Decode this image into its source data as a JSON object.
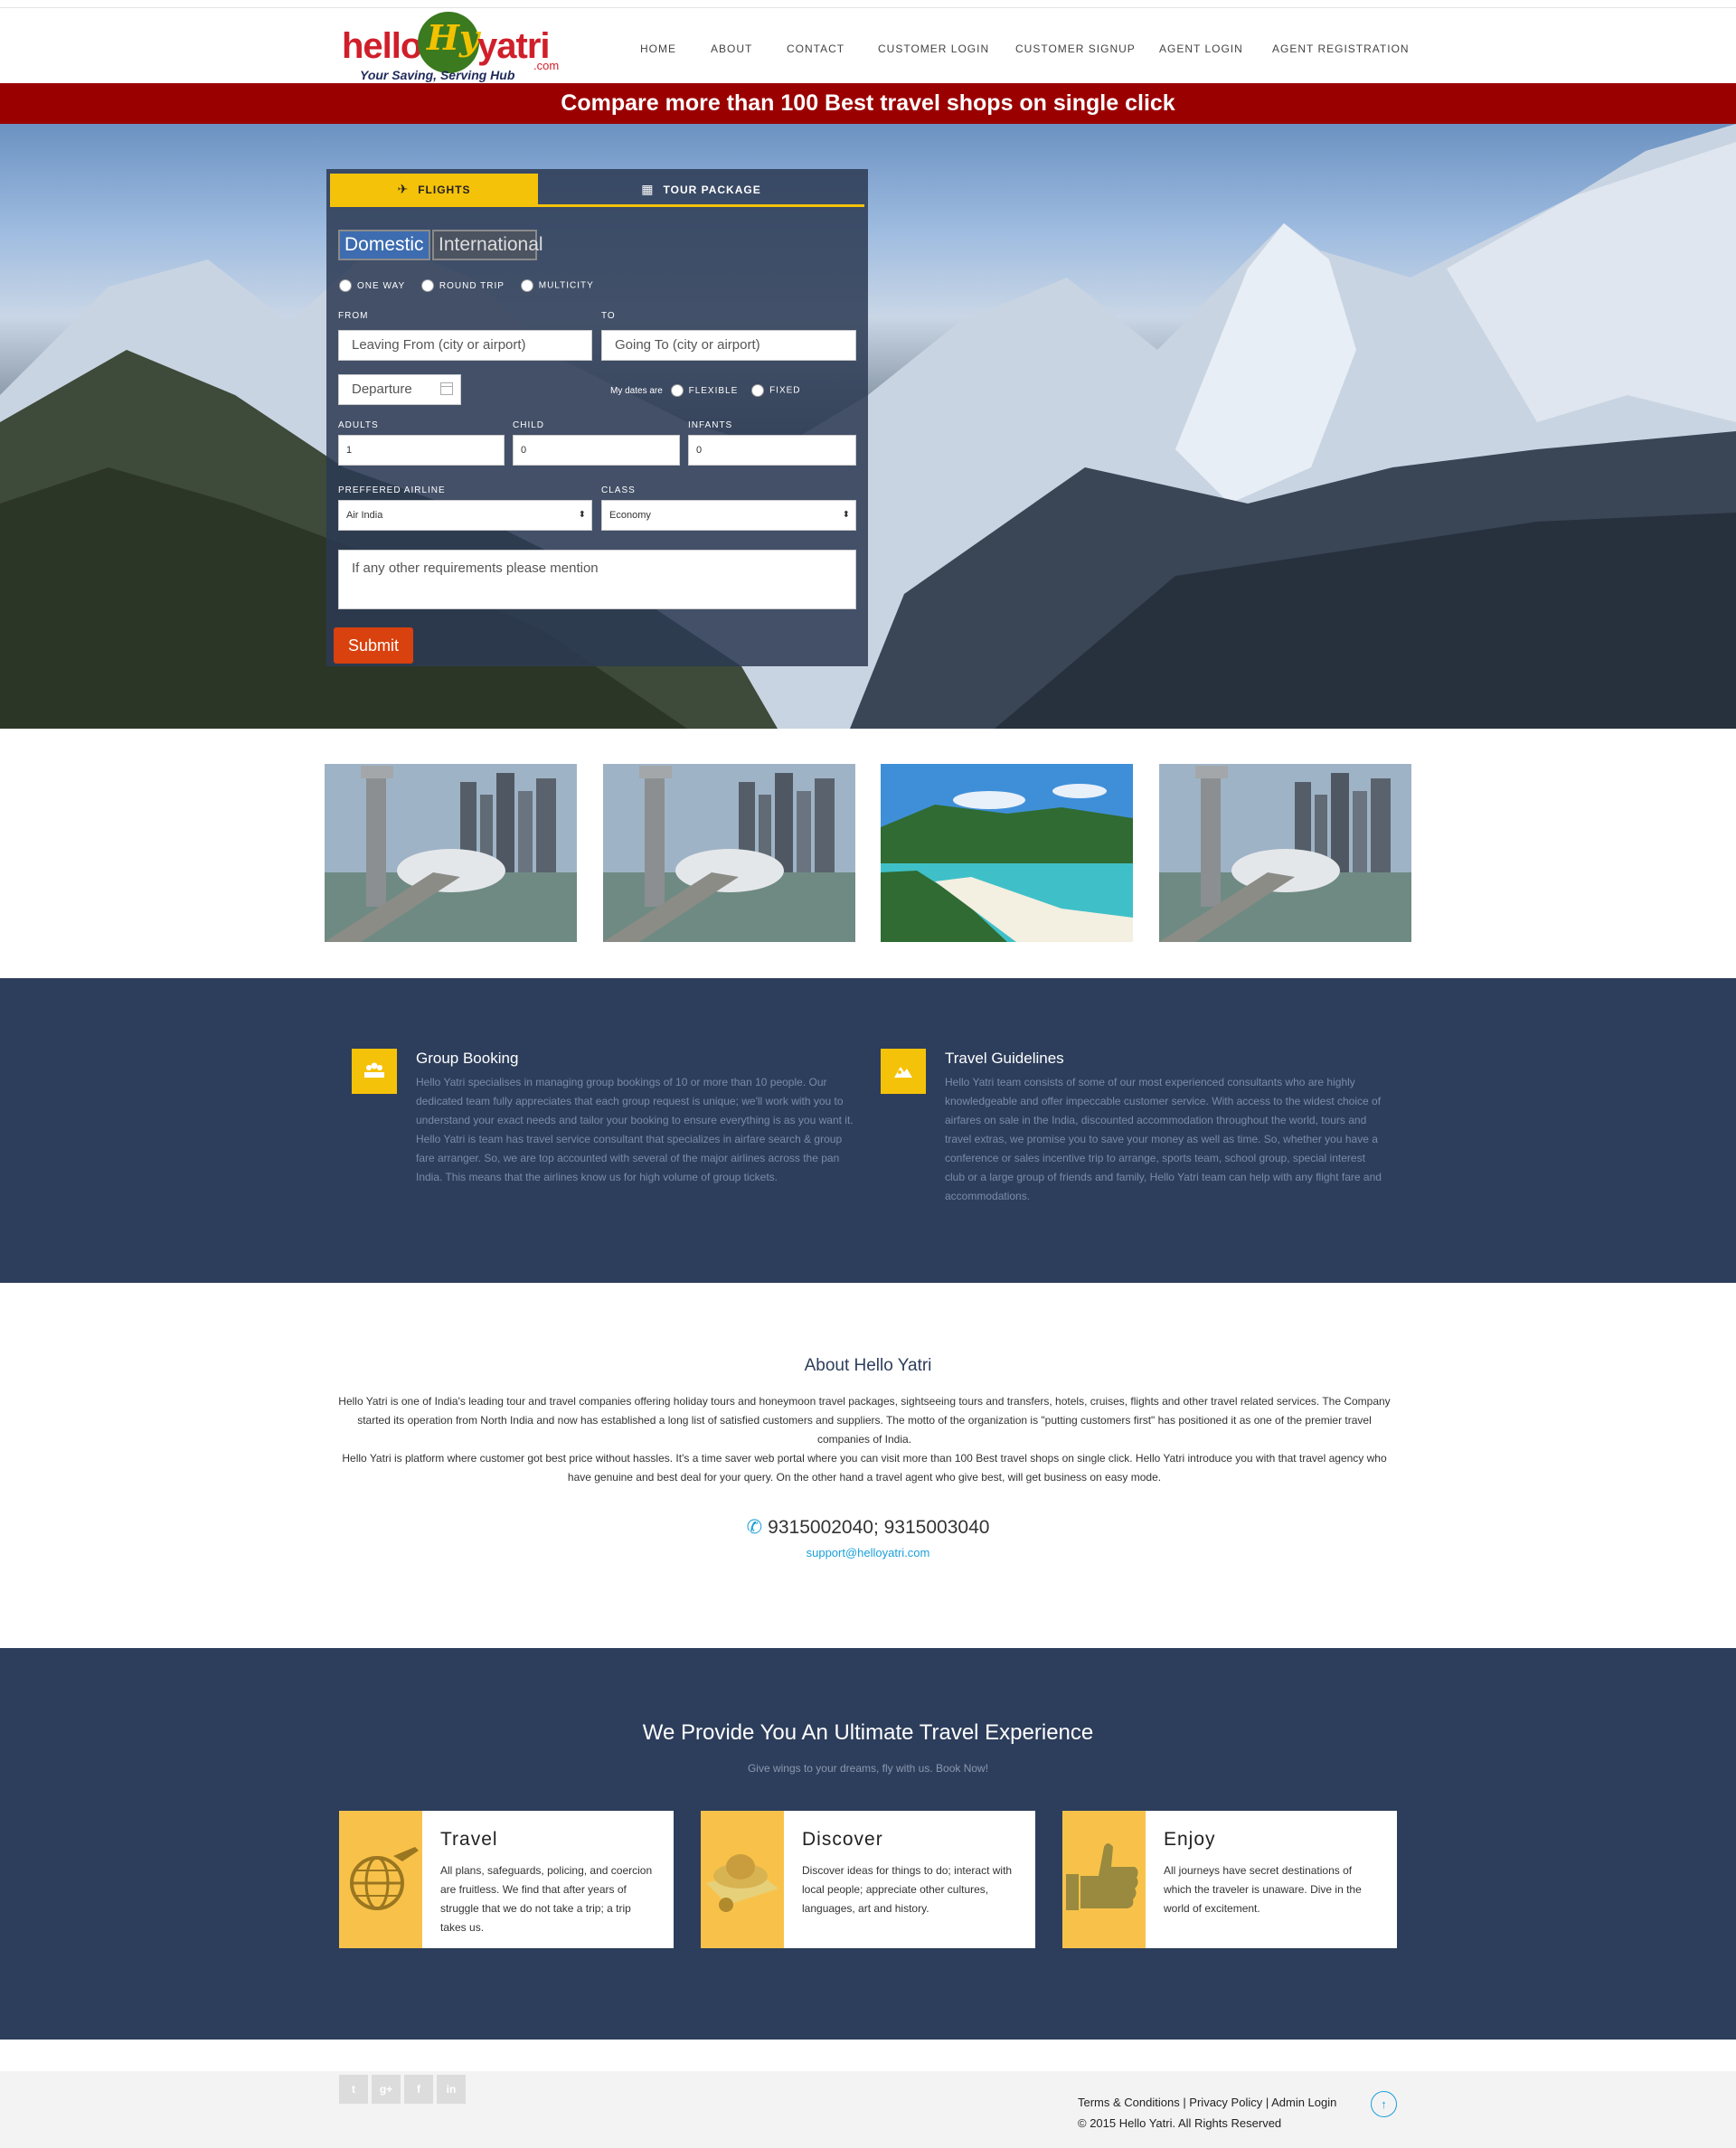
{
  "header": {
    "logo": {
      "hello": "hello",
      "hy": "Hy",
      "yatri": "yatri",
      "com": ".com",
      "tagline": "Your Saving, Serving Hub"
    },
    "nav": [
      "HOME",
      "ABOUT",
      "CONTACT",
      "CUSTOMER LOGIN",
      "CUSTOMER SIGNUP",
      "AGENT LOGIN",
      "AGENT REGISTRATION"
    ]
  },
  "banner": "Compare more than 100 Best travel shops on single click",
  "search_form": {
    "tabs": {
      "flights": "FLIGHTS",
      "tour": "TOUR PACKAGE"
    },
    "segments": {
      "domestic": "Domestic",
      "international": "International"
    },
    "trip_types": [
      "ONE WAY",
      "ROUND TRIP",
      "MULTICITY"
    ],
    "from_label": "FROM",
    "to_label": "TO",
    "from_placeholder": "Leaving From (city or airport)",
    "to_placeholder": "Going To (city or airport)",
    "departure_placeholder": "Departure",
    "dates_label": "My dates are",
    "flexible": "FLEXIBLE",
    "fixed": "FIXED",
    "adults_label": "ADULTS",
    "child_label": "CHILD",
    "infants_label": "INFANTS",
    "adults_value": "1",
    "child_value": "0",
    "infants_value": "0",
    "airline_label": "PREFFERED AIRLINE",
    "class_label": "CLASS",
    "airline_value": "Air India",
    "class_value": "Economy",
    "requirements_placeholder": "If any other requirements please mention",
    "submit_label": "Submit"
  },
  "features": [
    {
      "icon": "group-icon",
      "title": "Group Booking",
      "text": "Hello Yatri specialises in managing group bookings of 10 or more than 10 people. Our dedicated team fully appreciates that each group request is unique; we'll work with you to understand your exact needs and tailor your booking to ensure everything is as you want it. Hello Yatri is team has travel service consultant that specializes in airfare search & group fare arranger. So, we are top accounted with several of the major airlines across the pan India. This means that the airlines know us for high volume of group tickets."
    },
    {
      "icon": "mountain-icon",
      "title": "Travel Guidelines",
      "text": "Hello Yatri team consists of some of our most experienced consultants who are highly knowledgeable and offer impeccable customer service. With access to the widest choice of airfares on sale in the India, discounted accommodation throughout the world, tours and travel extras, we promise you to save your money as well as time. So, whether you have a conference or sales incentive trip to arrange, sports team, school group, special interest club or a large group of friends and family, Hello Yatri team can help with any flight fare and accommodations."
    }
  ],
  "about": {
    "title": "About Hello Yatri",
    "p1": "Hello Yatri is one of India's leading tour and travel companies offering holiday tours and honeymoon travel packages, sightseeing tours and transfers, hotels, cruises, flights and other travel related services. The Company started its operation from North India and now has established a long list of satisfied customers and suppliers. The motto of the organization is \"putting customers first\" has positioned it as one of the premier travel companies of India.",
    "p2": "Hello Yatri is platform where customer got best price without hassles. It's a time saver web portal where you can visit more than 100 Best travel shops on single click. Hello Yatri introduce you with that travel agency who have genuine and best deal for your query. On the other hand a travel agent who give best, will get business on easy mode.",
    "phone": "9315002040; 9315003040",
    "email": "support@helloyatri.com"
  },
  "experience": {
    "title": "We Provide You An Ultimate Travel Experience",
    "subtitle": "Give wings to your dreams, fly with us. Book Now!",
    "cards": [
      {
        "icon": "globe-plane-icon",
        "title": "Travel",
        "text": "All plans, safeguards, policing, and coercion are fruitless. We find that after years of struggle that we do not take a trip; a trip takes us."
      },
      {
        "icon": "map-hat-icon",
        "title": "Discover",
        "text": "Discover ideas for things to do; interact with local people; appreciate other cultures, languages, art and history."
      },
      {
        "icon": "thumbs-up-icon",
        "title": "Enjoy",
        "text": "All journeys have secret destinations of which the traveler is unaware. Dive in the world of excitement."
      }
    ]
  },
  "footer": {
    "social": [
      "twitter-icon",
      "google-plus-icon",
      "facebook-icon",
      "linkedin-icon"
    ],
    "social_glyphs": [
      "t",
      "g+",
      "f",
      "in"
    ],
    "links": "Terms & Conditions | Privacy Policy | Admin Login",
    "copyright": "© 2015 Hello Yatri. All Rights Reserved",
    "to_top": "↑"
  },
  "colors": {
    "banner": "#9b0000",
    "accent": "#f5c20a",
    "dark_section": "#2d3e5c",
    "submit": "#d9410e",
    "link": "#1ba0d8"
  }
}
